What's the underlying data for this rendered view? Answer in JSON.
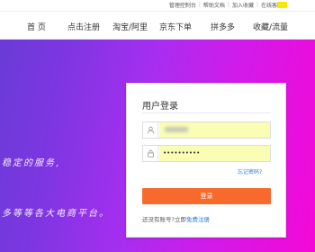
{
  "topbar": {
    "links": [
      "管理控制台",
      "帮助文档",
      "加入收藏",
      "在线客服"
    ],
    "separator": "|"
  },
  "nav": {
    "items": [
      "首 页",
      "点击注册",
      "淘宝/阿里",
      "京东下单",
      "拼多多",
      "收藏/流量"
    ]
  },
  "hero": {
    "line1": "稳定的服务,",
    "line2": "多等等各大电商平台。"
  },
  "login": {
    "title": "用户登录",
    "password_value": "••••••••••",
    "forgot": "忘记密码?",
    "button": "登录",
    "register_prefix": "还没有账号?立即",
    "register_link": "免费注册"
  },
  "colors": {
    "accent_button": "#f76a2c",
    "link": "#2b7bd8",
    "autofill": "#fafdb4",
    "badge": "#ffe600"
  }
}
